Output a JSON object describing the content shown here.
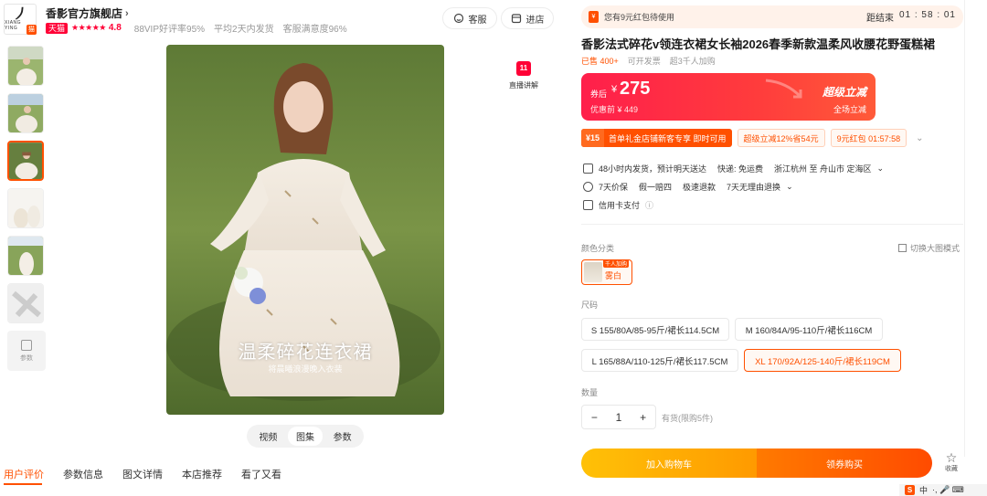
{
  "shop": {
    "logo_mark": "⵰",
    "logo_text": "XIANG YING",
    "name": "香影官方旗舰店",
    "badge": "天猫",
    "stars": "★★★★★",
    "rating": "4.8",
    "meta": [
      "88VIP好评率95%",
      "平均2天内发货",
      "客服满意度96%"
    ]
  },
  "top_actions": {
    "service": "客服",
    "enter": "进店"
  },
  "thumbnails": {
    "more_label": "参数"
  },
  "main_image": {
    "caption": "温柔碎花连衣裙",
    "subcaption": "将晨曦浪漫晚入衣装"
  },
  "live": {
    "label": "直播讲解"
  },
  "media_tabs": [
    "视频",
    "图集",
    "参数"
  ],
  "bottom_tabs": [
    "用户评价",
    "参数信息",
    "图文详情",
    "本店推荐",
    "看了又看"
  ],
  "coupon_bar": {
    "text": "您有9元红包待使用",
    "timer_label": "距结束",
    "timer": "01 : 58 : 01"
  },
  "product": {
    "title": "香影法式碎花v领连衣裙女长袖2026春季新款温柔风收腰花野蛋糕裙",
    "sold": "已售 400+",
    "invoice": "可开发票",
    "added": "超3千人加购"
  },
  "price": {
    "prefix": "券后",
    "currency": "¥",
    "value": "275",
    "original": "优惠前 ¥ 449",
    "deal": "超级立减",
    "deal_sub": "全场立减"
  },
  "promos": {
    "main_value": "¥15",
    "main_text": "首单礼金店铺新客专享 即时可用",
    "tag1": "超级立减12%省54元",
    "tag2": "9元红包 01:57:58"
  },
  "services": {
    "ship": "48小时内发货，预计明天送达",
    "express": "快递: 免运费",
    "route": "浙江杭州 至 舟山市 定海区",
    "price_protect": "7天价保",
    "compensate": "假一赔四",
    "refund": "极速退款",
    "return": "7天无理由退换",
    "credit": "信用卡支付"
  },
  "colors": {
    "label": "颜色分类",
    "switch_view": "切换大图模式",
    "option": "雾白",
    "option_flag": "千人加购"
  },
  "sizes": {
    "label": "尺码",
    "options": [
      "S 155/80A/85-95斤/裙长114.5CM",
      "M 160/84A/95-110斤/裙长116CM",
      "L 165/88A/110-125斤/裙长117.5CM",
      "XL 170/92A/125-140斤/裙长119CM"
    ],
    "selected": "XL 170/92A/125-140斤/裙长119CM"
  },
  "quantity": {
    "label": "数量",
    "minus": "−",
    "value": "1",
    "plus": "+",
    "stock": "有货(限购5件)"
  },
  "actions": {
    "add_cart": "加入购物车",
    "buy_now": "领券购买",
    "favorite": "收藏"
  },
  "ime": {
    "s": "S",
    "lang": "中",
    "rest": "·, 🎤 ⌨"
  },
  "colors_theme": {
    "accent": "#ff5000",
    "price_red": "#ff1f4b",
    "cart_yellow": "#ffc107"
  }
}
